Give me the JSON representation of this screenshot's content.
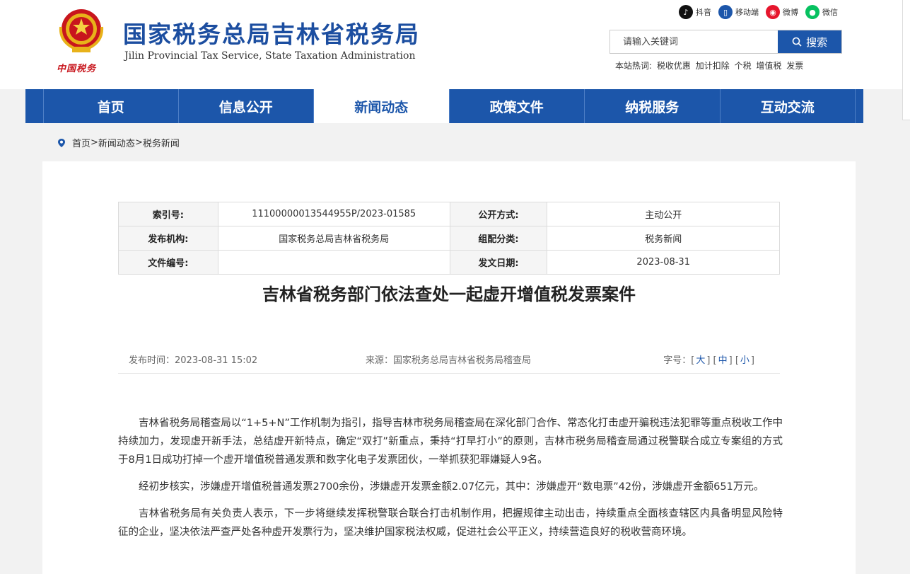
{
  "header": {
    "title": "国家税务总局吉林省税务局",
    "subtitle": "Jilin Provincial Tax Service, State Taxation Administration",
    "slogan": "中国税务",
    "social": [
      {
        "label": "抖音",
        "icon": "tiktok-icon",
        "color": "#111111",
        "glyph": "♪"
      },
      {
        "label": "移动端",
        "icon": "mobile-icon",
        "color": "#1c56aa",
        "glyph": "▯"
      },
      {
        "label": "微博",
        "icon": "weibo-icon",
        "color": "#e6162d",
        "glyph": "◉"
      },
      {
        "label": "微信",
        "icon": "wechat-icon",
        "color": "#07c160",
        "glyph": "●"
      }
    ],
    "search": {
      "placeholder": "请输入关键词",
      "button_label": "搜索"
    },
    "hot_words_label": "本站热词:",
    "hot_words": [
      "税收优惠",
      "加计扣除",
      "个税",
      "增值税",
      "发票"
    ]
  },
  "nav": {
    "items": [
      {
        "label": "首页",
        "active": false
      },
      {
        "label": "信息公开",
        "active": false
      },
      {
        "label": "新闻动态",
        "active": true
      },
      {
        "label": "政策文件",
        "active": false
      },
      {
        "label": "纳税服务",
        "active": false
      },
      {
        "label": "互动交流",
        "active": false
      }
    ]
  },
  "breadcrumb": {
    "items": [
      "首页",
      "新闻动态",
      "税务新闻"
    ],
    "separator": ">"
  },
  "meta": {
    "index_label": "索引号:",
    "index_value": "11100000013544955P/2023-01585",
    "open_label": "公开方式:",
    "open_value": "主动公开",
    "org_label": "发布机构:",
    "org_value": "国家税务总局吉林省税务局",
    "category_label": "组配分类:",
    "category_value": "税务新闻",
    "doc_label": "文件编号:",
    "doc_value": "",
    "date_label": "发文日期:",
    "date_value": "2023-08-31"
  },
  "article": {
    "title": "吉林省税务部门依法查处一起虚开增值税发票案件",
    "publish_time": "发布时间：2023-08-31 15:02",
    "source": "来源：国家税务总局吉林省税务局稽查局",
    "font_size_label": "字号：",
    "font_sizes": [
      "大",
      "中",
      "小"
    ],
    "paragraphs": [
      "吉林省税务局稽查局以“1+5+N”工作机制为指引，指导吉林市税务局稽查局在深化部门合作、常态化打击虚开骗税违法犯罪等重点税收工作中持续加力，发现虚开新手法，总结虚开新特点，确定“双打”新重点，秉持“打早打小”的原则，吉林市税务局稽查局通过税警联合成立专案组的方式于8月1日成功打掉一个虚开增值税普通发票和数字化电子发票团伙，一举抓获犯罪嫌疑人9名。",
      "经初步核实，涉嫌虚开增值税普通发票2700余份，涉嫌虚开发票金额2.07亿元，其中：涉嫌虚开“数电票”42份，涉嫌虚开金额651万元。",
      "吉林省税务局有关负责人表示，下一步将继续发挥税警联合联合打击机制作用，把握规律主动出击，持续重点全面核查辖区内具备明显风险特征的企业，坚决依法严查严处各种虚开发票行为，坚决维护国家税法权威，促进社会公平正义，持续营造良好的税收营商环境。"
    ]
  }
}
